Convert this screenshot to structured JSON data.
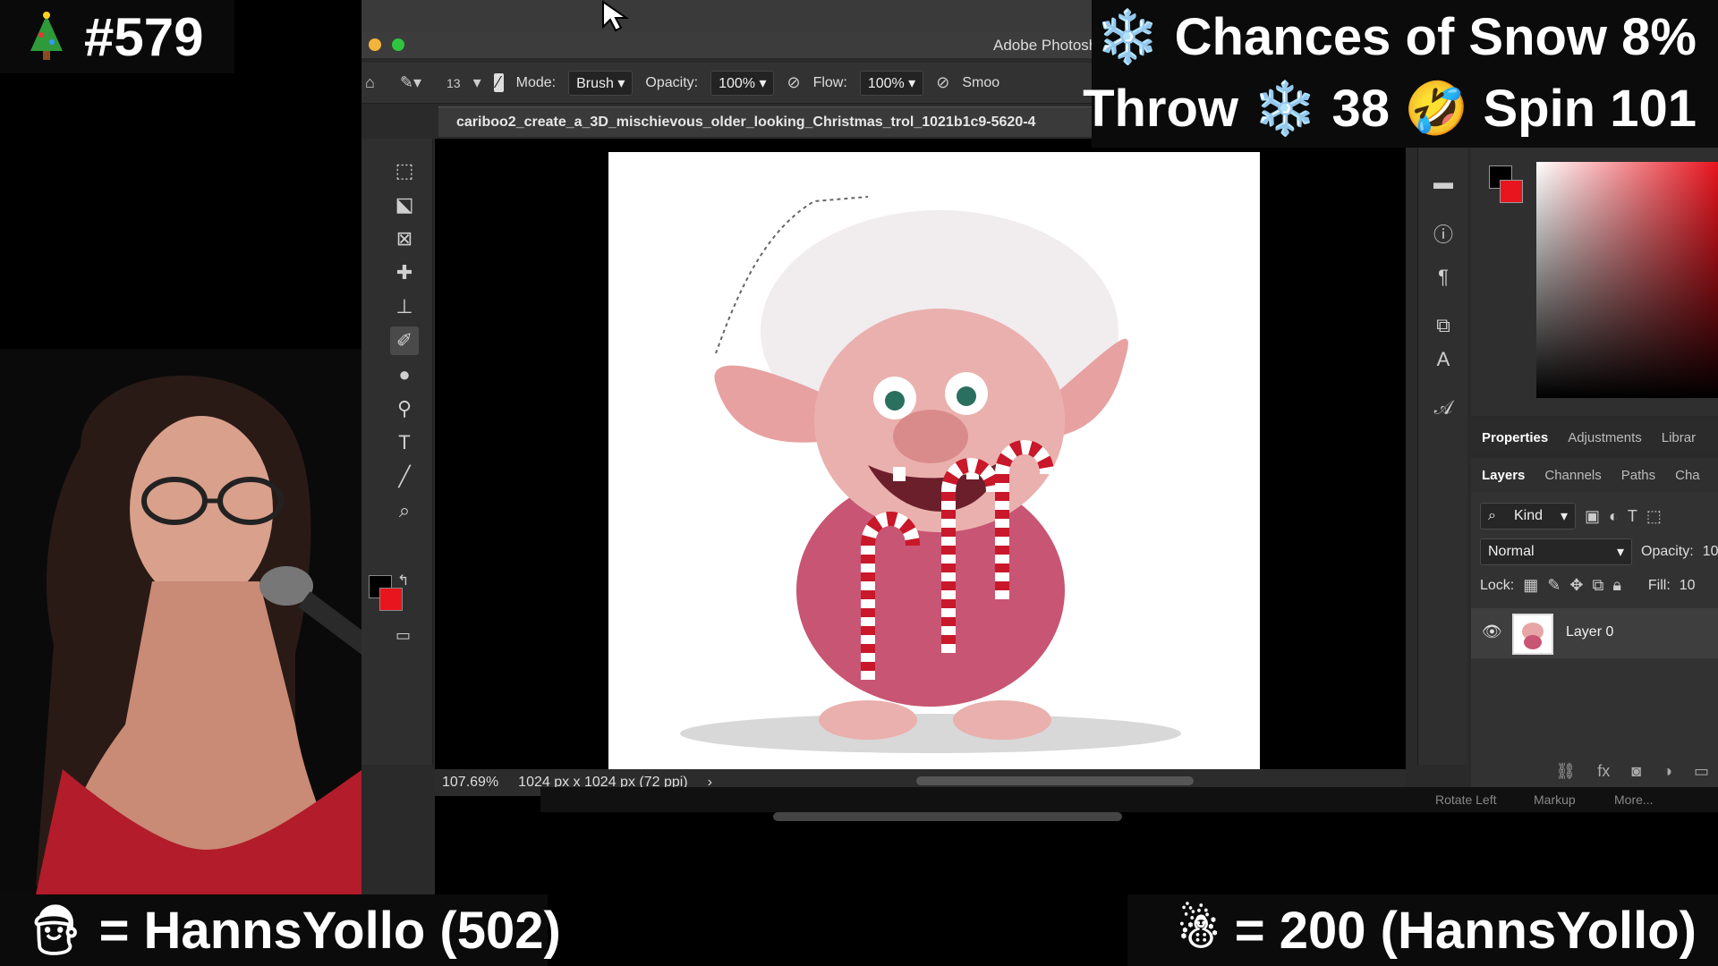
{
  "overlays": {
    "counter": {
      "icon": "christmas-tree",
      "text": "#579"
    },
    "snow_line": "❄️ Chances of Snow 8%",
    "throw_line": "Throw ❄️ 38 🤣 Spin 101",
    "bottom_left": "= HannsYollo (502)",
    "bottom_right": "= 200 (HannsYollo)"
  },
  "photoshop": {
    "app_title": "Adobe Photoshop",
    "options_bar": {
      "brush_size": "13",
      "mode_label": "Mode:",
      "mode_value": "Brush",
      "opacity_label": "Opacity:",
      "opacity_value": "100%",
      "flow_label": "Flow:",
      "flow_value": "100%",
      "smoothing_label": "Smoo"
    },
    "document_tab": "cariboo2_create_a_3D_mischievous_older_looking_Christmas_trol_1021b1c9-5620-4",
    "status": {
      "zoom": "107.69%",
      "dimensions": "1024 px x 1024 px (72 ppi)",
      "arrow": "›"
    },
    "bottom_strip": {
      "rotate_left": "Rotate Left",
      "markup": "Markup",
      "more": "More..."
    },
    "panels": {
      "properties_tabs": [
        "Properties",
        "Adjustments",
        "Librar"
      ],
      "layers_tabs": [
        "Layers",
        "Channels",
        "Paths",
        "Cha"
      ],
      "kind_label": "Kind",
      "blend_mode": "Normal",
      "opacity_label": "Opacity:",
      "opacity_value": "10",
      "lock_label": "Lock:",
      "fill_label": "Fill:",
      "fill_value": "10",
      "layer_name": "Layer 0"
    },
    "colors": {
      "foreground": "#000000",
      "background": "#e8141e"
    }
  }
}
